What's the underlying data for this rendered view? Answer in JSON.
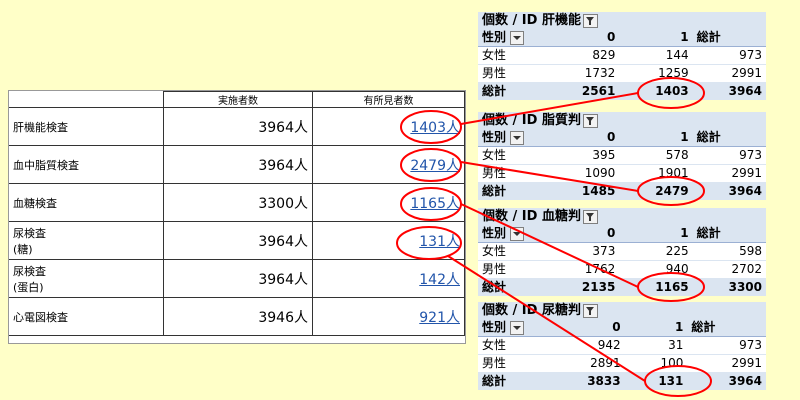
{
  "summary": {
    "headers": [
      "実施者数",
      "有所見者数"
    ],
    "rows": [
      {
        "label": "肝機能検査",
        "label2": "",
        "examinees": "3964人",
        "findings": "1403人"
      },
      {
        "label": "血中脂質検査",
        "label2": "",
        "examinees": "3964人",
        "findings": "2479人"
      },
      {
        "label": "血糖検査",
        "label2": "",
        "examinees": "3300人",
        "findings": "1165人"
      },
      {
        "label": "尿検査",
        "label2": "(糖)",
        "examinees": "3964人",
        "findings": "131人"
      },
      {
        "label": "尿検査",
        "label2": "(蛋白)",
        "examinees": "3964人",
        "findings": "142人"
      },
      {
        "label": "心電図検査",
        "label2": "",
        "examinees": "3946人",
        "findings": "921人"
      }
    ]
  },
  "pivots": [
    {
      "title": "個数 / ID 肝機能",
      "row_header": "性別",
      "col0": "0",
      "col1": "1",
      "total_label": "総計",
      "rows": [
        {
          "label": "女性",
          "v0": "829",
          "v1": "144",
          "t": "973"
        },
        {
          "label": "男性",
          "v0": "1732",
          "v1": "1259",
          "t": "2991"
        }
      ],
      "total": {
        "label": "総計",
        "v0": "2561",
        "v1": "1403",
        "t": "3964"
      }
    },
    {
      "title": "個数 / ID 脂質判",
      "row_header": "性別",
      "col0": "0",
      "col1": "1",
      "total_label": "総計",
      "rows": [
        {
          "label": "女性",
          "v0": "395",
          "v1": "578",
          "t": "973"
        },
        {
          "label": "男性",
          "v0": "1090",
          "v1": "1901",
          "t": "2991"
        }
      ],
      "total": {
        "label": "総計",
        "v0": "1485",
        "v1": "2479",
        "t": "3964"
      }
    },
    {
      "title": "個数 / ID 血糖判",
      "row_header": "性別",
      "col0": "0",
      "col1": "1",
      "total_label": "総計",
      "rows": [
        {
          "label": "女性",
          "v0": "373",
          "v1": "225",
          "t": "598"
        },
        {
          "label": "男性",
          "v0": "1762",
          "v1": "940",
          "t": "2702"
        }
      ],
      "total": {
        "label": "総計",
        "v0": "2135",
        "v1": "1165",
        "t": "3300"
      }
    },
    {
      "title": "個数 / ID 尿糖判",
      "row_header": "性別",
      "col0": "0",
      "col1": "1",
      "total_label": "総計",
      "rows": [
        {
          "label": "女性",
          "v0": "942",
          "v1": "31",
          "t": "973"
        },
        {
          "label": "男性",
          "v0": "2891",
          "v1": "100",
          "t": "2991"
        }
      ],
      "total": {
        "label": "総計",
        "v0": "3833",
        "v1": "131",
        "t": "3964"
      }
    }
  ],
  "colors": {
    "background": "#ffffc8",
    "pivot_header": "#dbe5f1",
    "highlight": "#ff0000",
    "link": "#2255aa"
  }
}
